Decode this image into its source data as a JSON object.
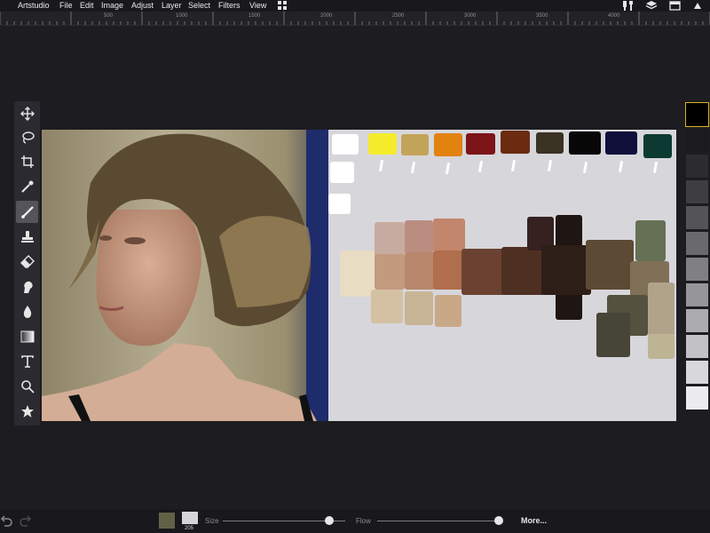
{
  "app": {
    "name": "Artstudio",
    "menu": [
      "File",
      "Edit",
      "Image",
      "Adjust",
      "Layer",
      "Select",
      "Filters",
      "View"
    ]
  },
  "ruler": {
    "labels": [
      "500",
      "1000",
      "1500",
      "2000",
      "2500",
      "3000",
      "3500",
      "4000"
    ]
  },
  "toolbar": {
    "tools": [
      {
        "name": "move-tool",
        "icon": "move-icon"
      },
      {
        "name": "lasso-tool",
        "icon": "lasso-icon"
      },
      {
        "name": "crop-tool",
        "icon": "crop-icon"
      },
      {
        "name": "eyedropper-tool",
        "icon": "eyedropper-icon"
      },
      {
        "name": "brush-tool",
        "icon": "brush-icon",
        "active": true
      },
      {
        "name": "stamp-tool",
        "icon": "stamp-icon"
      },
      {
        "name": "eraser-tool",
        "icon": "eraser-icon"
      },
      {
        "name": "smudge-tool",
        "icon": "smudge-icon"
      },
      {
        "name": "blur-tool",
        "icon": "drop-icon"
      },
      {
        "name": "gradient-tool",
        "icon": "gradient-icon"
      },
      {
        "name": "text-tool",
        "icon": "text-icon"
      },
      {
        "name": "zoom-tool",
        "icon": "magnifier-icon"
      },
      {
        "name": "favorites-tool",
        "icon": "star-icon"
      }
    ]
  },
  "palette_colors": [
    "#ffffff",
    "#f4ec2b",
    "#c2a458",
    "#e2820f",
    "#7c1418",
    "#6b2b10",
    "#3a3222",
    "#070707",
    "#0f0f3a",
    "#0c3a33"
  ],
  "right_panel": {
    "grays": [
      "#000000",
      "#1b1b1e",
      "#2c2c30",
      "#3e3e42",
      "#545458",
      "#6a6a6e",
      "#808084",
      "#96969a",
      "#acacb0",
      "#c2c2c6",
      "#d8d8dc",
      "#ececf0",
      "#ffffff"
    ],
    "selected_outline": "#d9b320"
  },
  "bottom": {
    "size_label": "Size",
    "flow_label": "Flow",
    "more_label": "More...",
    "brush_size_value": "205",
    "primary_color": "#5f6246",
    "secondary_color": "#d5d4d9",
    "size_level": 0.87,
    "flow_level": 0.98
  }
}
